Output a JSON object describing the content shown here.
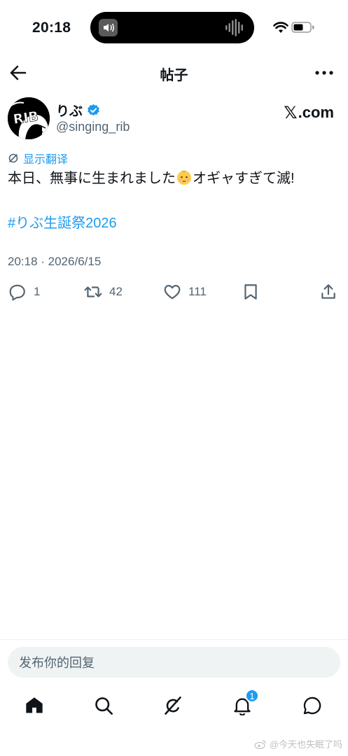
{
  "status_bar": {
    "time": "20:18"
  },
  "header": {
    "title": "帖子"
  },
  "author": {
    "display_name": "りぶ",
    "handle": "@singing_rib",
    "avatar_text": "RIB",
    "verified": true
  },
  "brand": {
    "text": ".com"
  },
  "translate": {
    "label": "显示翻译"
  },
  "tweet": {
    "text_before": "本日、無事に生まれました",
    "text_after": "オギャすぎて滅!",
    "hashtag": "#りぶ生誕祭2026",
    "timestamp": "20:18 · 2026/6/15"
  },
  "actions": {
    "replies": "1",
    "retweets": "42",
    "likes": "111"
  },
  "reply": {
    "placeholder": "发布你的回复"
  },
  "nav": {
    "notifications_badge": "1"
  },
  "watermark": {
    "text": "@今天也失眠了吗"
  },
  "colors": {
    "accent": "#1d9bf0",
    "muted": "#536471",
    "text": "#0f1419"
  },
  "icons": [
    "back-arrow-icon",
    "more-icon",
    "verified-icon",
    "translate-icon",
    "reply-icon",
    "retweet-icon",
    "like-icon",
    "bookmark-icon",
    "share-icon",
    "home-icon",
    "search-icon",
    "grok-icon",
    "notifications-icon",
    "messages-icon",
    "wifi-icon",
    "battery-icon",
    "baby-emoji-icon"
  ]
}
